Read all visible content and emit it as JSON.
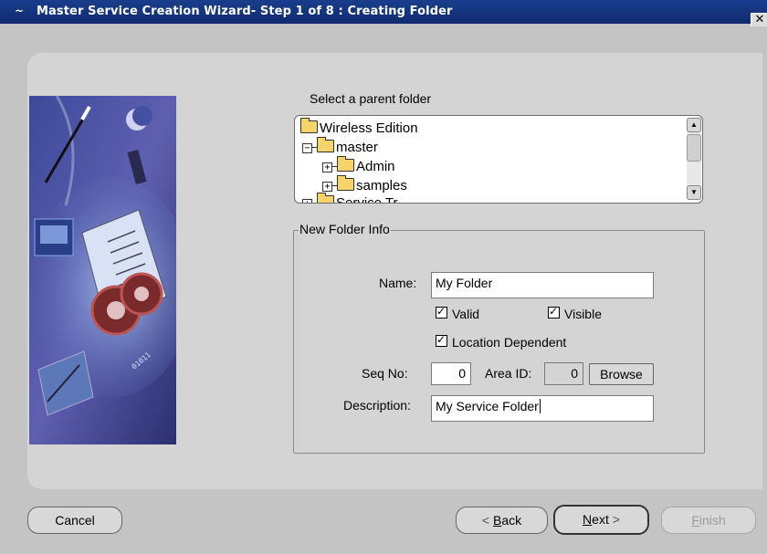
{
  "window": {
    "title": "Master Service Creation Wizard- Step 1 of 8 : Creating Folder",
    "close_glyph": "✕"
  },
  "parent_folder": {
    "label": "Select a parent folder",
    "tree": [
      {
        "label": "Wireless Edition",
        "expander": ""
      },
      {
        "label": "master",
        "expander": "−"
      },
      {
        "label": "Admin",
        "expander": "+"
      },
      {
        "label": "samples",
        "expander": "+"
      },
      {
        "label": "Service Tr",
        "expander": "+"
      }
    ]
  },
  "new_folder_info": {
    "legend": "New Folder Info",
    "name_label": "Name:",
    "name_value": "My Folder",
    "valid_label": "Valid",
    "valid_checked": true,
    "visible_label": "Visible",
    "visible_checked": true,
    "location_label": "Location Dependent",
    "location_checked": true,
    "seq_label": "Seq No:",
    "seq_value": "0",
    "area_label": "Area ID:",
    "area_value": "0",
    "browse_label": "Browse",
    "description_label": "Description:",
    "description_value": "My Service Folder"
  },
  "buttons": {
    "cancel": "Cancel",
    "back_prefix": "<",
    "back_accel": "B",
    "back_rest": "ack",
    "next_accel": "N",
    "next_rest": "ext",
    "next_suffix": ">",
    "finish_accel": "F",
    "finish_rest": "inish"
  },
  "colors": {
    "titlebar": "#1a3d8c",
    "panel": "#d4d4d4",
    "illustration_sky": "#3d3f8c"
  }
}
